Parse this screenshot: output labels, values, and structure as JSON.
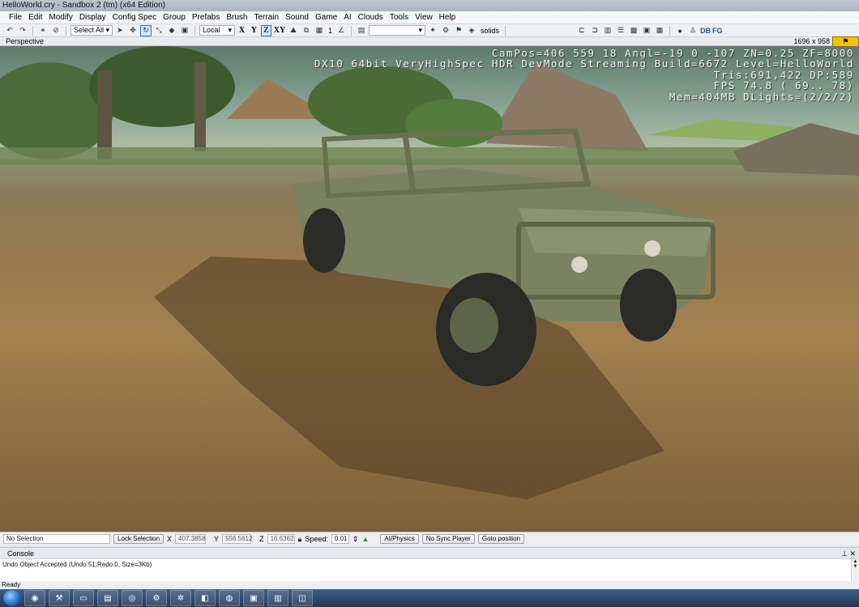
{
  "window": {
    "title": "HelloWorld.cry - Sandbox 2 (tm) (x64 Edition)"
  },
  "menu": [
    "File",
    "Edit",
    "Modify",
    "Display",
    "Config Spec",
    "Group",
    "Prefabs",
    "Brush",
    "Terrain",
    "Sound",
    "Game",
    "AI",
    "Clouds",
    "Tools",
    "View",
    "Help"
  ],
  "toolbar": {
    "select_all": "Select All",
    "coord_system": "Local",
    "axis_x": "X",
    "axis_y": "Y",
    "axis_z": "Z",
    "axis_xy": "XY",
    "grid_value": "1",
    "solids": "solids",
    "db_label": "DB",
    "fg_label": "FG"
  },
  "viewport": {
    "title": "Perspective",
    "resolution": "1696 x 958",
    "hud_lines": [
      "CamPos=406 559  18 Angl=-19  0 -107 ZN=0.25 ZF=8000",
      "DX10 64bit VeryHighSpec HDR DevMode Streaming Build=6672 Level=HelloWorld",
      "Tris:691,422  DP:589",
      "FPS  74.8 ( 69.. 78)",
      "Mem=404MB DLights=(2/2/2)"
    ]
  },
  "status": {
    "selection": "No Selection",
    "lock_selection": "Lock Selection",
    "x_label": "X",
    "x_value": "407.3858",
    "y_label": "Y",
    "y_value": "556.5612",
    "z_label": "Z",
    "z_value": "16.6362",
    "speed_label": "Speed:",
    "speed_value": "0.01",
    "ai_physics": "AI/Physics",
    "no_sync_player": "No Sync Player",
    "goto_position": "Goto position"
  },
  "console": {
    "title": "Console",
    "log": "Undo Object Accepted (Undo:51,Redo:0, Size=3Kb)"
  },
  "statusbar": {
    "ready": "Ready"
  },
  "colors": {
    "accent": "#3a6fb5",
    "hud_text": "#f4f4f4",
    "ground": "#9a7a4e"
  }
}
